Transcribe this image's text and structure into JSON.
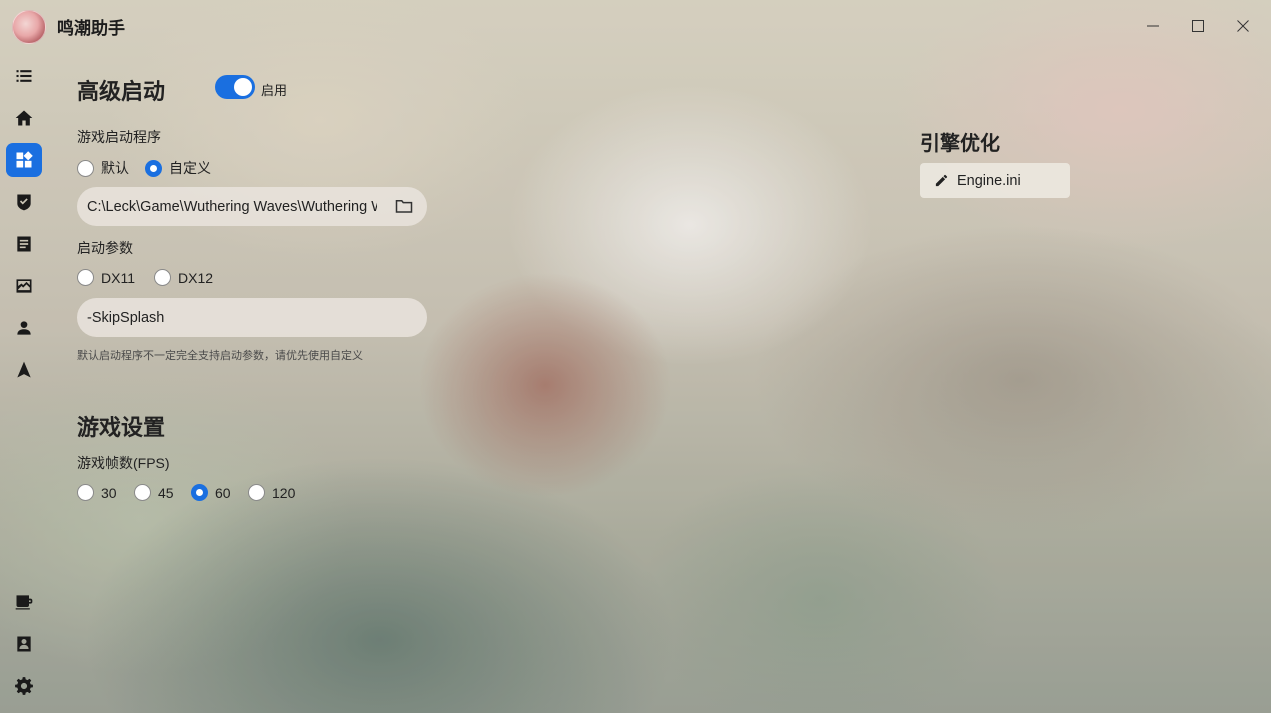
{
  "app": {
    "title": "鸣潮助手"
  },
  "window_controls": [
    "minimize-icon",
    "maximize-icon",
    "close-icon"
  ],
  "sidebar": {
    "top_items": [
      {
        "icon": "list-icon",
        "active": false
      },
      {
        "icon": "home-icon",
        "active": false
      },
      {
        "icon": "widgets-icon",
        "active": true
      },
      {
        "icon": "task-check-icon",
        "active": false
      },
      {
        "icon": "article-icon",
        "active": false
      },
      {
        "icon": "gallery-icon",
        "active": false
      },
      {
        "icon": "person-icon",
        "active": false
      },
      {
        "icon": "navigation-icon",
        "active": false
      }
    ],
    "bottom_items": [
      {
        "icon": "coffee-icon"
      },
      {
        "icon": "contact-icon"
      },
      {
        "icon": "settings-gear-icon"
      }
    ]
  },
  "advanced_launch": {
    "title": "高级启动",
    "toggle_label": "启用",
    "toggle_on": true,
    "launcher_label": "游戏启动程序",
    "launcher_options": [
      "默认",
      "自定义"
    ],
    "launcher_selected": "自定义",
    "path_value": "C:\\Leck\\Game\\Wuthering Waves\\Wuthering Waves Game\\Wuthering Waves.exe",
    "params_label": "启动参数",
    "dx_options": [
      "DX11",
      "DX12"
    ],
    "dx_selected": null,
    "params_value": "-SkipSplash",
    "hint": "默认启动程序不一定完全支持启动参数，请优先使用自定义"
  },
  "game_settings": {
    "title": "游戏设置",
    "fps_label": "游戏帧数(FPS)",
    "fps_options": [
      "30",
      "45",
      "60",
      "120"
    ],
    "fps_selected": "60"
  },
  "engine_optimization": {
    "title": "引擎优化",
    "button_label": "Engine.ini"
  },
  "colors": {
    "accent": "#1a6fe0",
    "text": "#222222"
  }
}
